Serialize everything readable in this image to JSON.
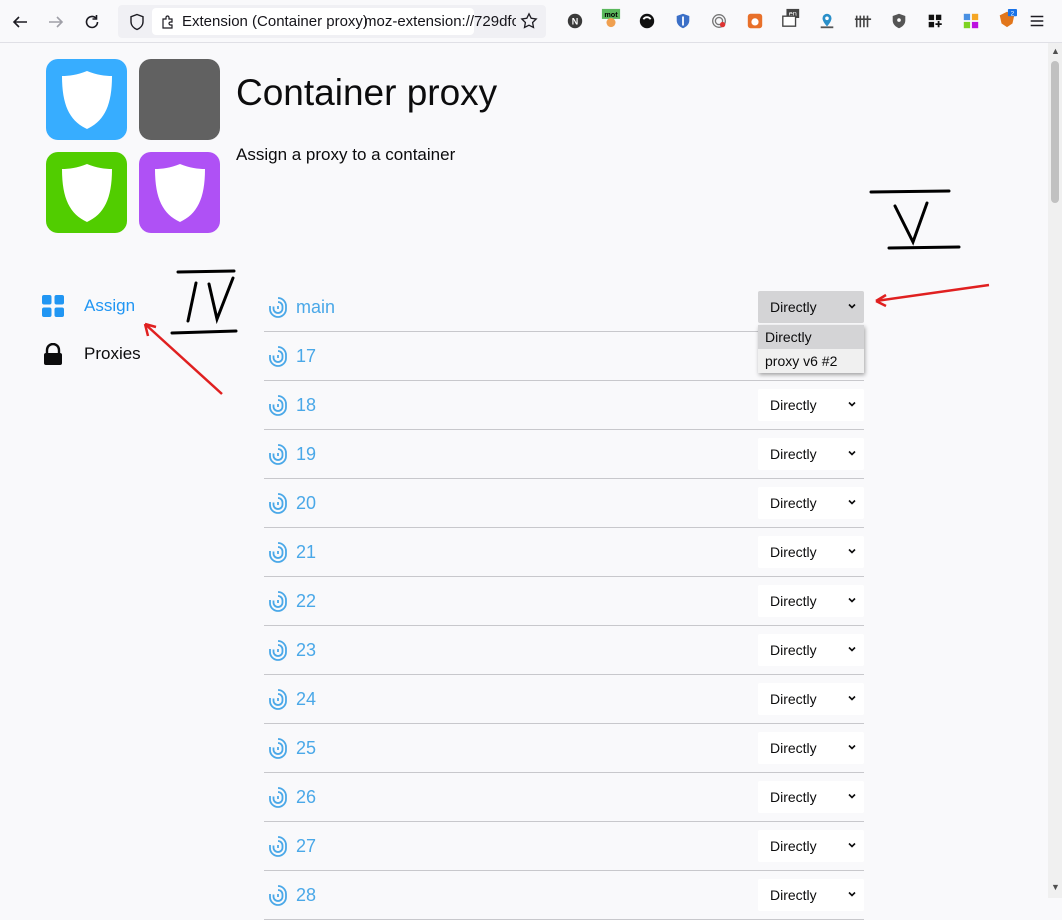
{
  "browser": {
    "tab_label": "Extension (Container proxy)",
    "url": "moz-extension://729dfcc",
    "extensions": [
      "notion-icon",
      "mot-translate-icon",
      "dark-reader-icon",
      "ghostery-icon",
      "fingerprint-icon",
      "fishbowl-icon",
      "en-translate-icon",
      "location-icon",
      "bars-icon",
      "privacy-badger-icon",
      "ublock-icon",
      "grid-plus-icon",
      "colorful-squares-icon",
      "metamask-icon"
    ],
    "badge_count": "2"
  },
  "header": {
    "title": "Container proxy",
    "subtitle": "Assign a proxy to a container"
  },
  "colors": {
    "tile_blue": "#37adff",
    "tile_gray": "#616161",
    "tile_green": "#51cd00",
    "tile_purple": "#af51f5",
    "accent": "#2196f3"
  },
  "sidebar": {
    "items": [
      {
        "label": "Assign",
        "icon": "grid-icon",
        "active": true
      },
      {
        "label": "Proxies",
        "icon": "lock-icon",
        "active": false
      }
    ]
  },
  "containers": [
    {
      "name": "main",
      "proxy": "Directly"
    },
    {
      "name": "17",
      "proxy": "Directly"
    },
    {
      "name": "18",
      "proxy": "Directly"
    },
    {
      "name": "19",
      "proxy": "Directly"
    },
    {
      "name": "20",
      "proxy": "Directly"
    },
    {
      "name": "21",
      "proxy": "Directly"
    },
    {
      "name": "22",
      "proxy": "Directly"
    },
    {
      "name": "23",
      "proxy": "Directly"
    },
    {
      "name": "24",
      "proxy": "Directly"
    },
    {
      "name": "25",
      "proxy": "Directly"
    },
    {
      "name": "26",
      "proxy": "Directly"
    },
    {
      "name": "27",
      "proxy": "Directly"
    },
    {
      "name": "28",
      "proxy": "Directly"
    }
  ],
  "dropdown": {
    "options": [
      "Directly",
      "proxy v6 #2"
    ]
  },
  "annotations": {
    "label_iv": "IV",
    "label_v": "V"
  }
}
